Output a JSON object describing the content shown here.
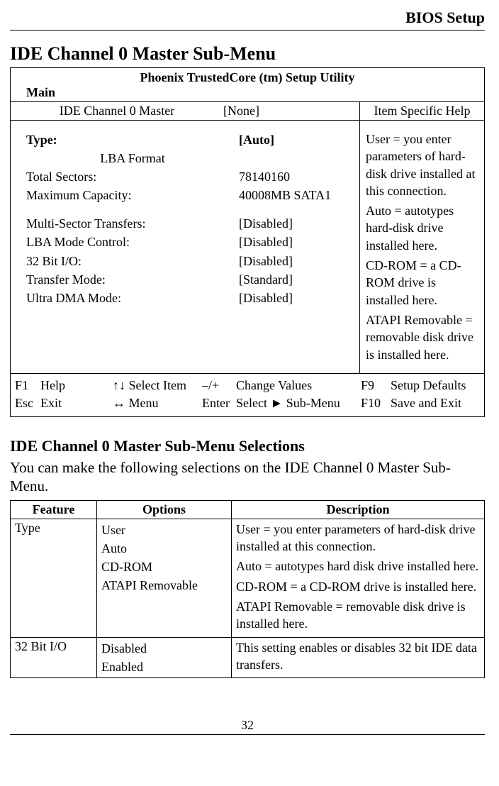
{
  "header": {
    "running_head": "BIOS Setup"
  },
  "section1_title": "IDE Channel 0 Master Sub-Menu",
  "bios": {
    "utility_title": "Phoenix TrustedCore (tm) Setup Utility",
    "menu_tab": "Main",
    "submenu_label": "IDE Channel 0 Master",
    "submenu_value": "[None]",
    "help_heading": "Item Specific Help",
    "rows": {
      "type_label": "Type:",
      "type_value": "[Auto]",
      "lba_format": "LBA Format",
      "total_sectors_label": "Total Sectors:",
      "total_sectors_value": "78140160",
      "max_capacity_label": "Maximum Capacity:",
      "max_capacity_value": "40008MB SATA1",
      "multi_sector_label": "Multi-Sector Transfers:",
      "multi_sector_value": "[Disabled]",
      "lba_mode_label": "LBA Mode Control:",
      "lba_mode_value": "[Disabled]",
      "bit32_label": "32 Bit I/O:",
      "bit32_value": "[Disabled]",
      "transfer_mode_label": "Transfer Mode:",
      "transfer_mode_value": "[Standard]",
      "ultra_dma_label": "Ultra DMA Mode:",
      "ultra_dma_value": "[Disabled]"
    },
    "help_text": {
      "p1": "User = you enter parameters of hard-disk drive installed at this connection.",
      "p2": "Auto = autotypes hard-disk drive installed here.",
      "p3": "CD-ROM = a CD-ROM drive is installed here.",
      "p4": "ATAPI Removable = removable disk drive is installed here."
    },
    "keys": {
      "r1c1": "F1",
      "r1c2": "Help",
      "r1c3": "↑↓ Select Item",
      "r1c4": "–/+",
      "r1c5": "Change Values",
      "r1c6": "F9",
      "r1c7": "Setup Defaults",
      "r2c1": "Esc",
      "r2c2": "Exit",
      "r2c3": "↔ Menu",
      "r2c4": "Enter",
      "r2c5": "Select ► Sub-Menu",
      "r2c6": "F10",
      "r2c7": "Save and Exit"
    }
  },
  "section2_title": "IDE Channel 0 Master Sub-Menu Selections",
  "section2_intro": "You can make the following selections on the IDE Channel 0 Master Sub-Menu.",
  "table": {
    "head": {
      "feature": "Feature",
      "options": "Options",
      "description": "Description"
    },
    "rows": [
      {
        "feature": "Type",
        "options": [
          "User",
          "Auto",
          "CD-ROM",
          "ATAPI Removable"
        ],
        "description": [
          "User = you enter parameters of hard-disk drive installed at this connection.",
          "Auto = autotypes hard disk drive installed here.",
          "CD-ROM = a CD-ROM drive is installed here.",
          "ATAPI Removable = removable disk drive is installed here."
        ]
      },
      {
        "feature": "32 Bit I/O",
        "options": [
          "Disabled",
          "Enabled"
        ],
        "description": [
          "This setting enables or disables 32 bit IDE data transfers."
        ]
      }
    ]
  },
  "page_number": "32"
}
